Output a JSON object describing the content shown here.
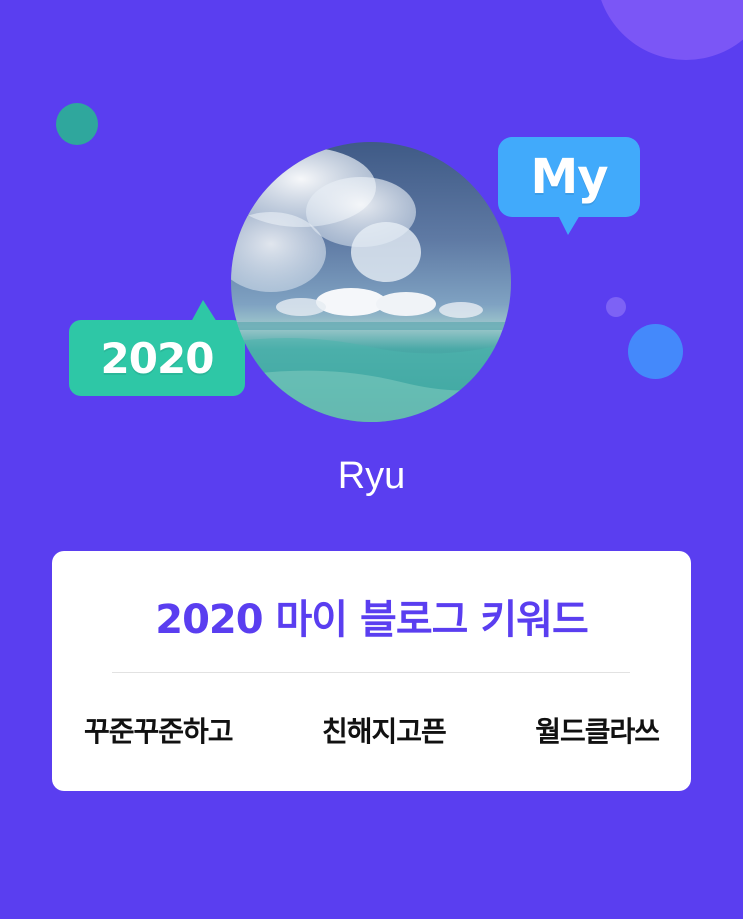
{
  "bubbles": {
    "my": "My",
    "year": "2020"
  },
  "profile": {
    "username": "Ryu",
    "avatar_image": "sky and sea photo"
  },
  "card": {
    "title": "2020 마이 블로그 키워드",
    "keywords": [
      "꾸준꾸준하고",
      "친해지고픈",
      "월드클라쓰"
    ]
  },
  "colors": {
    "background": "#5a3ef0",
    "accent": "#5a3ef0",
    "bubble_my": "#41aafb",
    "bubble_year": "#2ec7a6",
    "card": "#ffffff"
  }
}
